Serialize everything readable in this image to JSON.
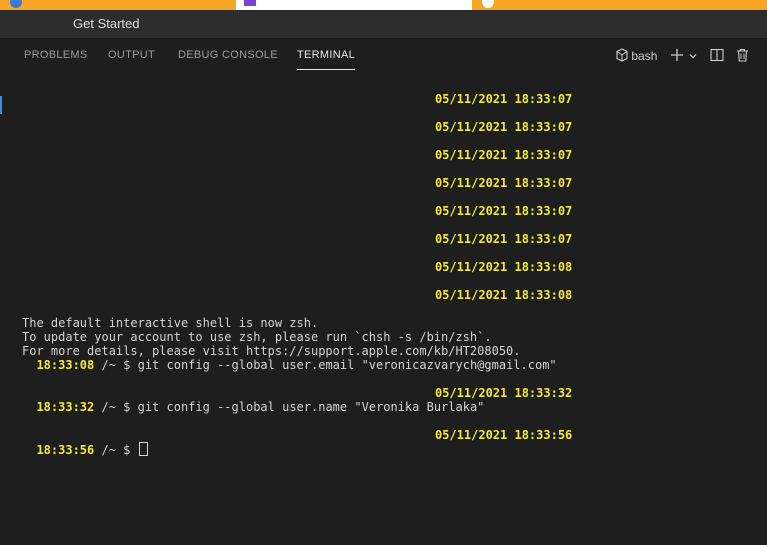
{
  "window": {
    "tab_title": "Get Started"
  },
  "panel": {
    "tabs": [
      {
        "label": "PROBLEMS"
      },
      {
        "label": "OUTPUT"
      },
      {
        "label": "DEBUG CONSOLE"
      },
      {
        "label": "TERMINAL",
        "active": true
      }
    ],
    "shell_name": "bash",
    "actions": [
      "shell-icon",
      "add-icon",
      "chevron-down-icon",
      "split-icon",
      "trash-icon"
    ]
  },
  "terminal": {
    "timestamps_top": [
      "05/11/2021 18:33:07",
      "05/11/2021 18:33:07",
      "05/11/2021 18:33:07",
      "05/11/2021 18:33:07",
      "05/11/2021 18:33:07",
      "05/11/2021 18:33:07",
      "05/11/2021 18:33:08",
      "05/11/2021 18:33:08"
    ],
    "notice_lines": [
      "The default interactive shell is now zsh.",
      "To update your account to use zsh, please run `chsh -s /bin/zsh`.",
      "For more details, please visit https://support.apple.com/kb/HT208050."
    ],
    "commands": [
      {
        "time": "18:33:08",
        "prompt": " /~ $ ",
        "cmd": "git config --global user.email \"veronicazvarych@gmail.com\""
      },
      {
        "time": "18:33:32",
        "prompt": " /~ $ ",
        "cmd": "git config --global user.name \"Veronika Burlaka\""
      },
      {
        "time": "18:33:56",
        "prompt": " /~ $ ",
        "cmd": ""
      }
    ],
    "command_timestamps": [
      "05/11/2021 18:33:32",
      "05/11/2021 18:33:56"
    ]
  },
  "colors": {
    "timestamp": "#f1e93b",
    "background": "#1e1e1e",
    "active_tab_underline": "#e7e7e7"
  }
}
